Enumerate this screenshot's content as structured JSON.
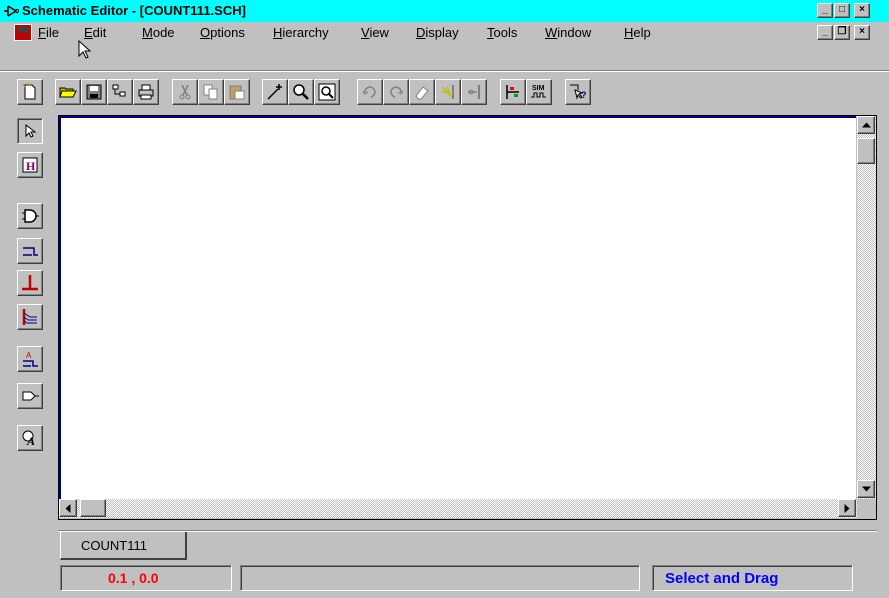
{
  "window": {
    "title": "Schematic Editor - [COUNT111.SCH]",
    "caption_buttons": [
      "minimize",
      "maximize",
      "close"
    ]
  },
  "menu": {
    "items": [
      "File",
      "Edit",
      "Mode",
      "Options",
      "Hierarchy",
      "View",
      "Display",
      "Tools",
      "Window",
      "Help"
    ],
    "mdi_buttons": [
      "minimize",
      "restore",
      "close"
    ]
  },
  "toolbar": {
    "icons": [
      "new-icon",
      "open-icon",
      "save-icon",
      "hierarchy-icon",
      "print-icon",
      "cut-icon",
      "copy-icon",
      "paste-icon",
      "add-wire-icon",
      "zoom-icon",
      "zoom-area-icon",
      "undo-icon",
      "redo-icon",
      "erase-icon",
      "add-bus-tap-icon",
      "remove-bus-tap-icon",
      "netlist-icon",
      "sim-icon",
      "help-pointer-icon"
    ],
    "sim_label": "SIM"
  },
  "palette": {
    "icons": [
      "select-icon",
      "hierarchy-h-icon",
      "and-gate-icon",
      "net-icon",
      "junction-icon",
      "bus-icon",
      "net-label-icon",
      "io-marker-icon",
      "text-icon"
    ],
    "hier_label": "H",
    "label_a": "A"
  },
  "tabs": [
    "COUNT111"
  ],
  "status": {
    "coordinates": "0.1 ,  0.0",
    "message": "",
    "mode": "Select and Drag"
  },
  "colors": {
    "titlebar": "#00ffff",
    "coord_text": "#ff0000",
    "mode_text": "#0000ff",
    "canvas": "#ffffff"
  }
}
